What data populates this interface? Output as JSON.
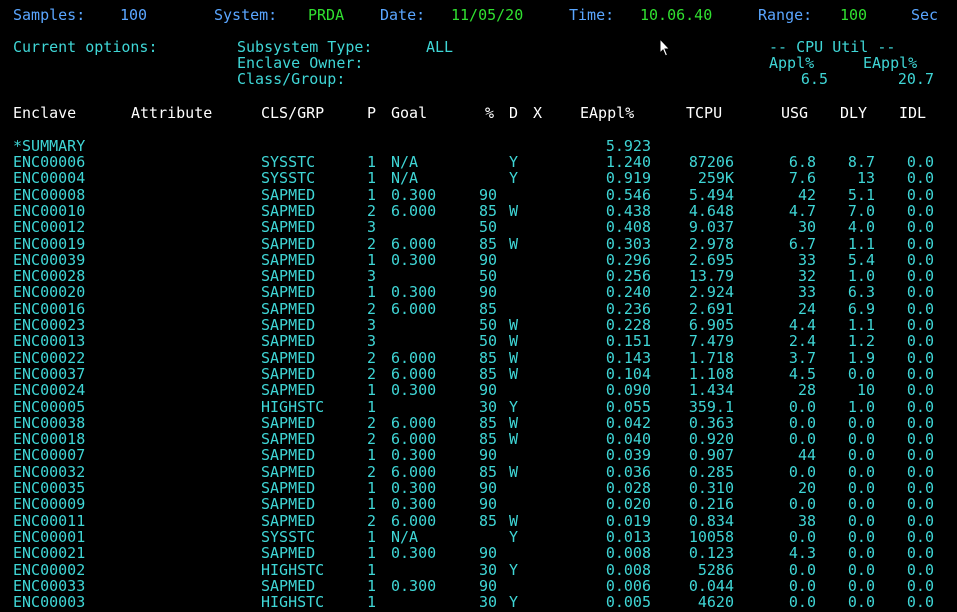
{
  "status_bar": {
    "samples_label": "Samples:",
    "samples_value": "100",
    "system_label": "System:",
    "system_value": "PRDA",
    "date_label": "Date:",
    "date_value": "11/05/20",
    "time_label": "Time:",
    "time_value": "10.06.40",
    "range_label": "Range:",
    "range_value": "100",
    "sec_label": "Sec"
  },
  "options": {
    "current_options_label": "Current options:",
    "subsystem_label": "Subsystem Type:",
    "subsystem_value": "ALL",
    "enclave_owner_label": "Enclave Owner:",
    "class_group_label": "Class/Group:",
    "cpu_util_label": "-- CPU Util --",
    "appl_label": "Appl%",
    "eappl_label": "EAppl%",
    "appl_value": "6.5",
    "eappl_value": "20.7"
  },
  "table": {
    "headers": {
      "enclave": "Enclave",
      "attribute": "Attribute",
      "clsgrp": "CLS/GRP",
      "p": "P",
      "goal": "Goal",
      "pct": "%",
      "d": "D",
      "x": "X",
      "eappl": "EAppl%",
      "tcpu": "TCPU",
      "usg": "USG",
      "dly": "DLY",
      "idl": "IDL"
    },
    "summary": {
      "name": "*SUMMARY",
      "eappl": "5.923"
    },
    "rows": [
      {
        "enclave": "ENC00006",
        "clsgrp": "SYSSTC",
        "p": "1",
        "goal": "N/A",
        "pct": "",
        "d": "Y",
        "eappl": "1.240",
        "tcpu": "87206",
        "usg": "6.8",
        "dly": "8.7",
        "idl": "0.0"
      },
      {
        "enclave": "ENC00004",
        "clsgrp": "SYSSTC",
        "p": "1",
        "goal": "N/A",
        "pct": "",
        "d": "Y",
        "eappl": "0.919",
        "tcpu": "259K",
        "usg": "7.6",
        "dly": "13",
        "idl": "0.0"
      },
      {
        "enclave": "ENC00008",
        "clsgrp": "SAPMED",
        "p": "1",
        "goal": "0.300",
        "pct": "90",
        "d": "",
        "eappl": "0.546",
        "tcpu": "5.494",
        "usg": "42",
        "dly": "5.1",
        "idl": "0.0"
      },
      {
        "enclave": "ENC00010",
        "clsgrp": "SAPMED",
        "p": "2",
        "goal": "6.000",
        "pct": "85",
        "d": "W",
        "eappl": "0.438",
        "tcpu": "4.648",
        "usg": "4.7",
        "dly": "7.0",
        "idl": "0.0"
      },
      {
        "enclave": "ENC00012",
        "clsgrp": "SAPMED",
        "p": "3",
        "goal": "",
        "pct": "50",
        "d": "",
        "eappl": "0.408",
        "tcpu": "9.037",
        "usg": "30",
        "dly": "4.0",
        "idl": "0.0"
      },
      {
        "enclave": "ENC00019",
        "clsgrp": "SAPMED",
        "p": "2",
        "goal": "6.000",
        "pct": "85",
        "d": "W",
        "eappl": "0.303",
        "tcpu": "2.978",
        "usg": "6.7",
        "dly": "1.1",
        "idl": "0.0"
      },
      {
        "enclave": "ENC00039",
        "clsgrp": "SAPMED",
        "p": "1",
        "goal": "0.300",
        "pct": "90",
        "d": "",
        "eappl": "0.296",
        "tcpu": "2.695",
        "usg": "33",
        "dly": "5.4",
        "idl": "0.0"
      },
      {
        "enclave": "ENC00028",
        "clsgrp": "SAPMED",
        "p": "3",
        "goal": "",
        "pct": "50",
        "d": "",
        "eappl": "0.256",
        "tcpu": "13.79",
        "usg": "32",
        "dly": "1.0",
        "idl": "0.0"
      },
      {
        "enclave": "ENC00020",
        "clsgrp": "SAPMED",
        "p": "1",
        "goal": "0.300",
        "pct": "90",
        "d": "",
        "eappl": "0.240",
        "tcpu": "2.924",
        "usg": "33",
        "dly": "6.3",
        "idl": "0.0"
      },
      {
        "enclave": "ENC00016",
        "clsgrp": "SAPMED",
        "p": "2",
        "goal": "6.000",
        "pct": "85",
        "d": "",
        "eappl": "0.236",
        "tcpu": "2.691",
        "usg": "24",
        "dly": "6.9",
        "idl": "0.0"
      },
      {
        "enclave": "ENC00023",
        "clsgrp": "SAPMED",
        "p": "3",
        "goal": "",
        "pct": "50",
        "d": "W",
        "eappl": "0.228",
        "tcpu": "6.905",
        "usg": "4.4",
        "dly": "1.1",
        "idl": "0.0"
      },
      {
        "enclave": "ENC00013",
        "clsgrp": "SAPMED",
        "p": "3",
        "goal": "",
        "pct": "50",
        "d": "W",
        "eappl": "0.151",
        "tcpu": "7.479",
        "usg": "2.4",
        "dly": "1.2",
        "idl": "0.0"
      },
      {
        "enclave": "ENC00022",
        "clsgrp": "SAPMED",
        "p": "2",
        "goal": "6.000",
        "pct": "85",
        "d": "W",
        "eappl": "0.143",
        "tcpu": "1.718",
        "usg": "3.7",
        "dly": "1.9",
        "idl": "0.0"
      },
      {
        "enclave": "ENC00037",
        "clsgrp": "SAPMED",
        "p": "2",
        "goal": "6.000",
        "pct": "85",
        "d": "W",
        "eappl": "0.104",
        "tcpu": "1.108",
        "usg": "4.5",
        "dly": "0.0",
        "idl": "0.0"
      },
      {
        "enclave": "ENC00024",
        "clsgrp": "SAPMED",
        "p": "1",
        "goal": "0.300",
        "pct": "90",
        "d": "",
        "eappl": "0.090",
        "tcpu": "1.434",
        "usg": "28",
        "dly": "10",
        "idl": "0.0"
      },
      {
        "enclave": "ENC00005",
        "clsgrp": "HIGHSTC",
        "p": "1",
        "goal": "",
        "pct": "30",
        "d": "Y",
        "eappl": "0.055",
        "tcpu": "359.1",
        "usg": "0.0",
        "dly": "1.0",
        "idl": "0.0"
      },
      {
        "enclave": "ENC00038",
        "clsgrp": "SAPMED",
        "p": "2",
        "goal": "6.000",
        "pct": "85",
        "d": "W",
        "eappl": "0.042",
        "tcpu": "0.363",
        "usg": "0.0",
        "dly": "0.0",
        "idl": "0.0"
      },
      {
        "enclave": "ENC00018",
        "clsgrp": "SAPMED",
        "p": "2",
        "goal": "6.000",
        "pct": "85",
        "d": "W",
        "eappl": "0.040",
        "tcpu": "0.920",
        "usg": "0.0",
        "dly": "0.0",
        "idl": "0.0"
      },
      {
        "enclave": "ENC00007",
        "clsgrp": "SAPMED",
        "p": "1",
        "goal": "0.300",
        "pct": "90",
        "d": "",
        "eappl": "0.039",
        "tcpu": "0.907",
        "usg": "44",
        "dly": "0.0",
        "idl": "0.0"
      },
      {
        "enclave": "ENC00032",
        "clsgrp": "SAPMED",
        "p": "2",
        "goal": "6.000",
        "pct": "85",
        "d": "W",
        "eappl": "0.036",
        "tcpu": "0.285",
        "usg": "0.0",
        "dly": "0.0",
        "idl": "0.0"
      },
      {
        "enclave": "ENC00035",
        "clsgrp": "SAPMED",
        "p": "1",
        "goal": "0.300",
        "pct": "90",
        "d": "",
        "eappl": "0.028",
        "tcpu": "0.310",
        "usg": "20",
        "dly": "0.0",
        "idl": "0.0"
      },
      {
        "enclave": "ENC00009",
        "clsgrp": "SAPMED",
        "p": "1",
        "goal": "0.300",
        "pct": "90",
        "d": "",
        "eappl": "0.020",
        "tcpu": "0.216",
        "usg": "0.0",
        "dly": "0.0",
        "idl": "0.0"
      },
      {
        "enclave": "ENC00011",
        "clsgrp": "SAPMED",
        "p": "2",
        "goal": "6.000",
        "pct": "85",
        "d": "W",
        "eappl": "0.019",
        "tcpu": "0.834",
        "usg": "38",
        "dly": "0.0",
        "idl": "0.0"
      },
      {
        "enclave": "ENC00001",
        "clsgrp": "SYSSTC",
        "p": "1",
        "goal": "N/A",
        "pct": "",
        "d": "Y",
        "eappl": "0.013",
        "tcpu": "10058",
        "usg": "0.0",
        "dly": "0.0",
        "idl": "0.0"
      },
      {
        "enclave": "ENC00021",
        "clsgrp": "SAPMED",
        "p": "1",
        "goal": "0.300",
        "pct": "90",
        "d": "",
        "eappl": "0.008",
        "tcpu": "0.123",
        "usg": "4.3",
        "dly": "0.0",
        "idl": "0.0"
      },
      {
        "enclave": "ENC00002",
        "clsgrp": "HIGHSTC",
        "p": "1",
        "goal": "",
        "pct": "30",
        "d": "Y",
        "eappl": "0.008",
        "tcpu": "5286",
        "usg": "0.0",
        "dly": "0.0",
        "idl": "0.0"
      },
      {
        "enclave": "ENC00033",
        "clsgrp": "SAPMED",
        "p": "1",
        "goal": "0.300",
        "pct": "90",
        "d": "",
        "eappl": "0.006",
        "tcpu": "0.044",
        "usg": "0.0",
        "dly": "0.0",
        "idl": "0.0"
      },
      {
        "enclave": "ENC00003",
        "clsgrp": "HIGHSTC",
        "p": "1",
        "goal": "",
        "pct": "30",
        "d": "Y",
        "eappl": "0.005",
        "tcpu": "4620",
        "usg": "0.0",
        "dly": "0.0",
        "idl": "0.0"
      }
    ]
  },
  "colors": {
    "background": "#000000",
    "label_blue": "#5aa6ff",
    "value_green": "#30e030",
    "header_white": "#ffffff",
    "data_cyan": "#3fd6d6"
  },
  "icons": {
    "cursor": "mouse-pointer-icon"
  }
}
